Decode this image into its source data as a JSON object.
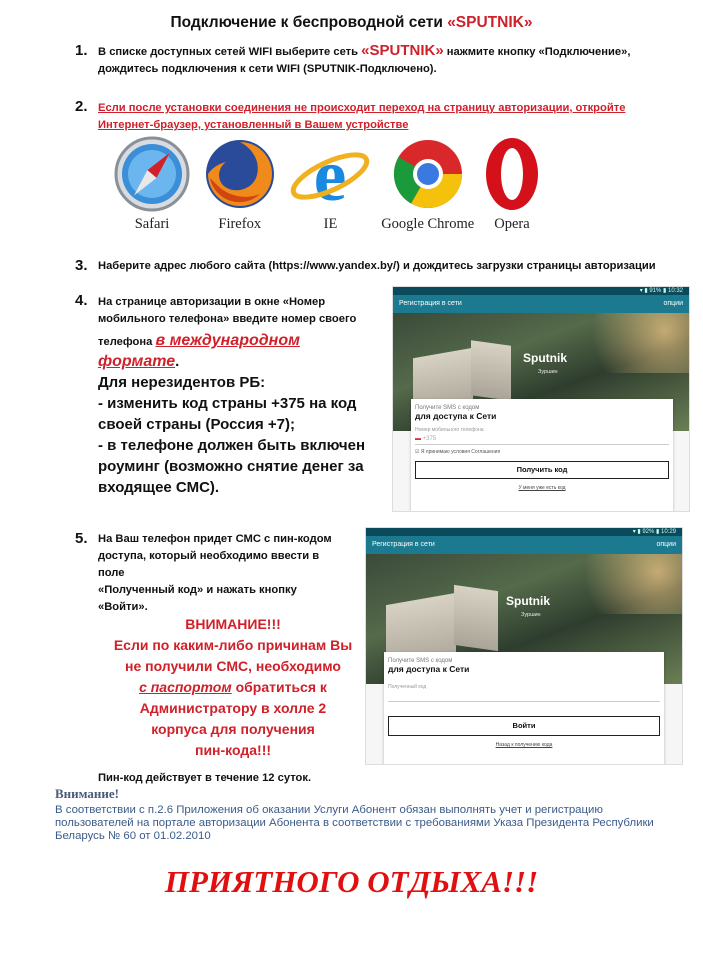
{
  "title": {
    "text": "Подключение к беспроводной сети ",
    "brand": "«SPUTNIK»"
  },
  "steps": [
    {
      "num": "1.",
      "part1": "В списке доступных сетей WIFI выберите сеть ",
      "brand": "«SPUTNIK»",
      "part2": " нажмите кнопку «Подключение»,",
      "line2": "дождитесь подключения к сети WIFI (SPUTNIK-Подключено)."
    },
    {
      "num": "2.",
      "line1": "Если после установки соединения не происходит переход на страницу авторизации,  откройте",
      "line2": "Интернет-браузер, установленный в Вашем устройстве"
    },
    {
      "num": "3.",
      "text": "Наберите адрес любого сайта  (https://www.yandex.by/) и дождитесь загрузки страницы авторизации"
    },
    {
      "num": "4.",
      "line1": "На странице авторизации в окне «Номер",
      "line2": "мобильного телефона» введите номер своего",
      "line3a": "телефона ",
      "emph1": "в международном",
      "emph2": "формате",
      "line3end": ".",
      "big1": "Для нерезидентов РБ:",
      "big2": "- изменить код страны +375 на код",
      "big3": "своей страны (Россия +7);",
      "big4": "- в телефоне должен быть включен",
      "big5": "роуминг (возможно снятие денег за",
      "big6": "входящее СМС)."
    },
    {
      "num": "5.",
      "line1": "На Ваш телефон придет СМС с пин-кодом",
      "line2": "доступа, который необходимо ввести в",
      "line3": "поле",
      "line4": "«Полученный код» и нажать кнопку",
      "line5": "«Войти»."
    }
  ],
  "browsers": [
    {
      "label": "Safari",
      "icon": "safari-icon"
    },
    {
      "label": "Firefox",
      "icon": "firefox-icon"
    },
    {
      "label": "IE",
      "icon": "ie-icon"
    },
    {
      "label": "Google Chrome",
      "icon": "chrome-icon"
    },
    {
      "label": "Opera",
      "icon": "opera-icon"
    }
  ],
  "warning": {
    "w1": "ВНИМАНИЕ!!!",
    "w2": "Если по каким-либо причинам Вы",
    "w3": "не получили СМС, необходимо",
    "w4a": "с паспортом",
    "w4b": " обратиться к",
    "w5": "Администратору в холле 2",
    "w6": "корпуса для получения",
    "w7": "пин-кода!!!"
  },
  "pin_note": "Пин-код действует в течение 12 суток.",
  "notice": {
    "heading": "Внимание!",
    "l1": "В соответствии с п.2.6 Приложения об оказании Услуги Абонент обязан выполнять учет и регистрацию",
    "l2": "пользователей на портале авторизации Абонента в соответствии с требованиями Указа Президента Республики",
    "l3": "Беларусь № 60 от 01.02.2010"
  },
  "farewell": "ПРИЯТНОГО ОТДЫХА!!!",
  "phone1": {
    "status": "▾ ▮ 91% ▮ 10:32",
    "appbar_title": "Регистрация в сети",
    "appbar_action": "опции",
    "hotel": "Sputnik",
    "hotel_sub": "Зуршин",
    "card_s1": "Получите SMS с кодом",
    "card_s2": "для доступа к Сети",
    "field_label": "Номер мобильного телефона",
    "field_value": "+375",
    "terms": "Я принимаю условия Соглашения",
    "button": "Получить код",
    "link": "У меня уже есть код"
  },
  "phone2": {
    "status": "▾ ▮ 92% ▮ 10:29",
    "appbar_title": "Регистрация в сети",
    "appbar_action": "опции",
    "hotel": "Sputnik",
    "hotel_sub": "Зуршин",
    "card_s1": "Получите SMS с кодом",
    "card_s2": "для доступа к Сети",
    "field_label": "Полученный код",
    "button": "Войти",
    "link": "Назад к получению кода"
  }
}
